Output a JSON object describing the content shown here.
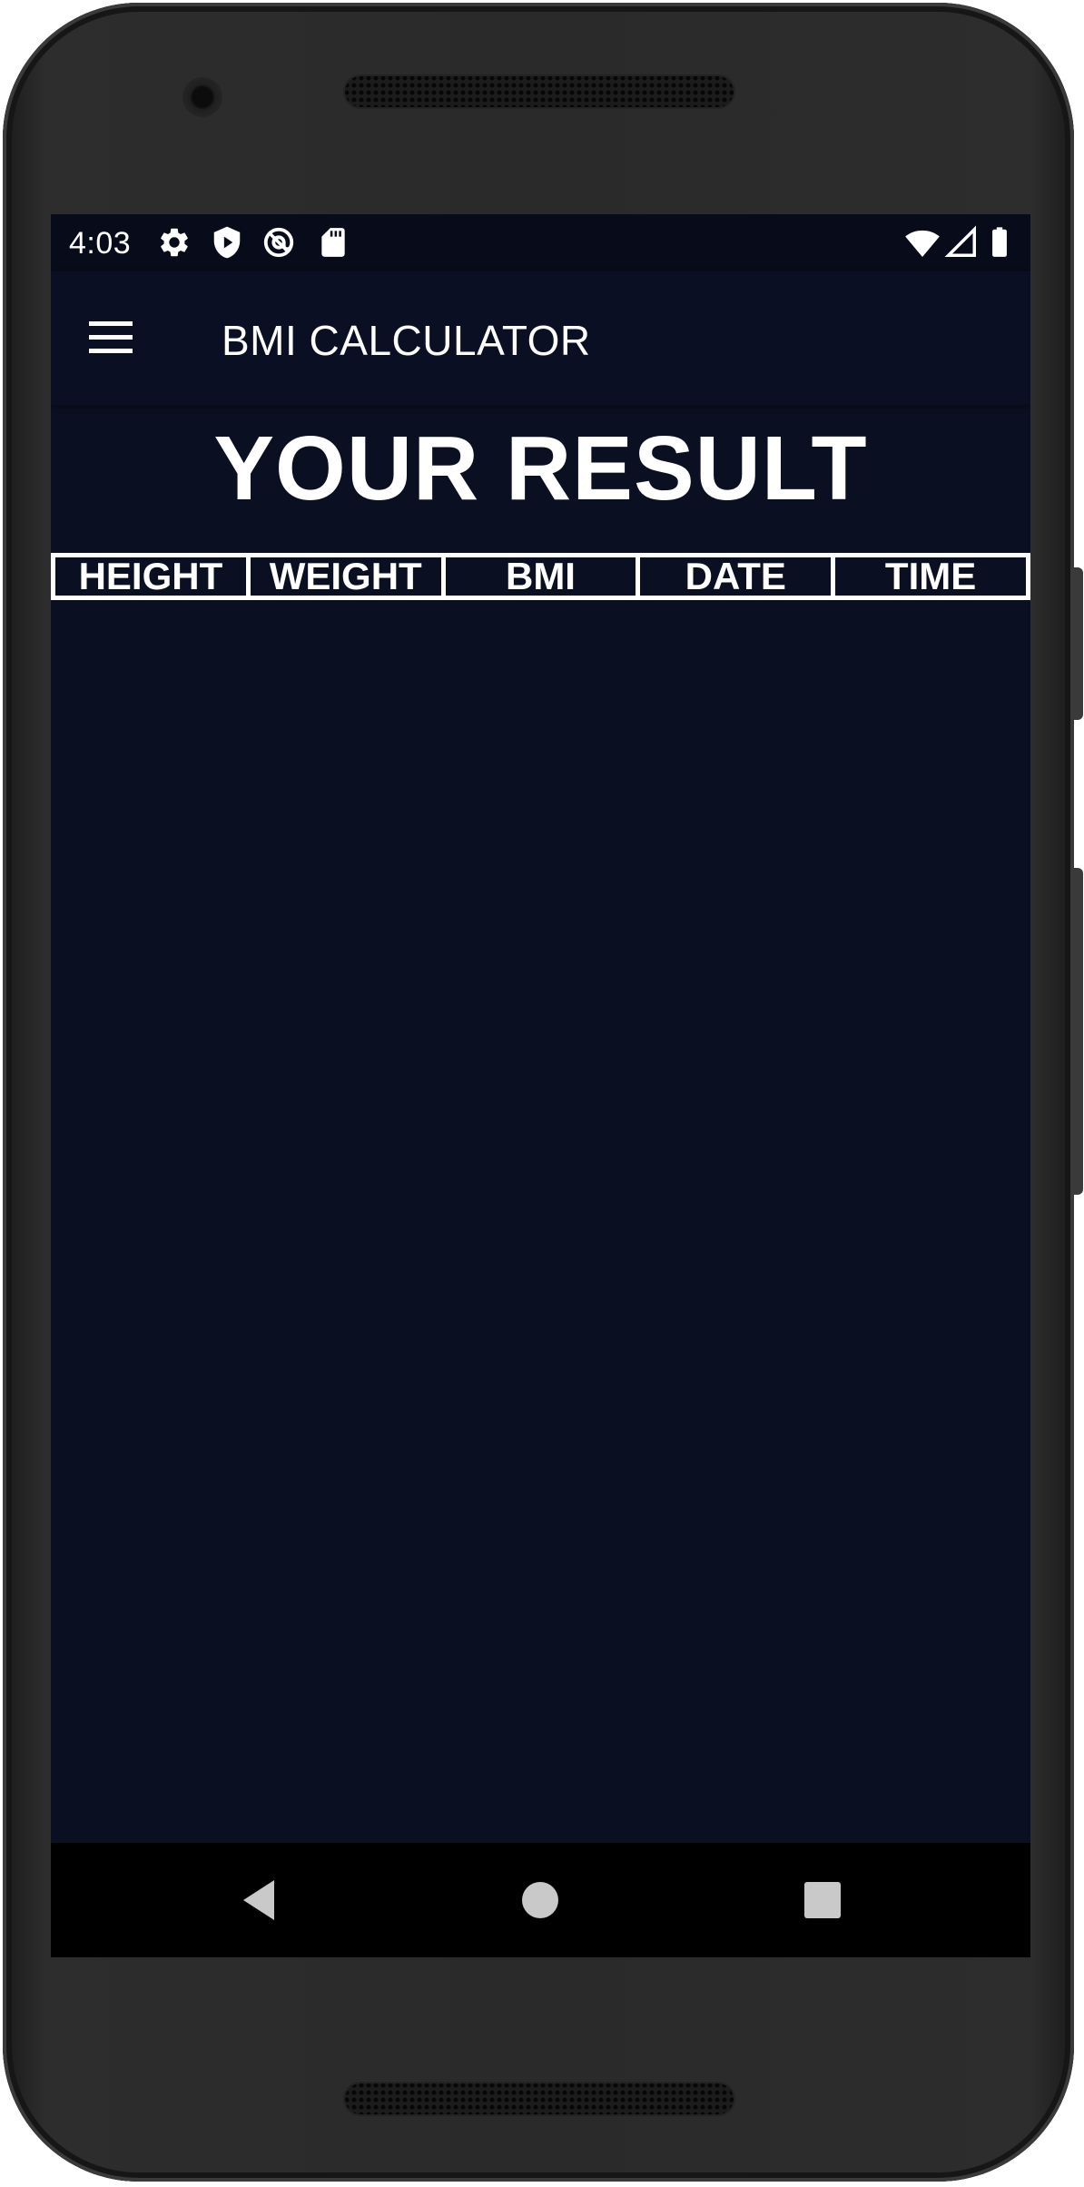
{
  "status_bar": {
    "time": "4:03",
    "left_icons": [
      "settings-icon",
      "shield-play-icon",
      "at-sign-icon",
      "sd-card-icon"
    ],
    "right_icons": [
      "wifi-icon",
      "cell-signal-icon",
      "battery-icon"
    ]
  },
  "app_bar": {
    "title": "BMI CALCULATOR",
    "menu_icon": "menu-icon"
  },
  "main": {
    "heading": "YOUR RESULT",
    "table_headers": [
      "HEIGHT",
      "WEIGHT",
      "BMI",
      "DATE",
      "TIME"
    ],
    "rows": []
  },
  "nav_bar": {
    "buttons": [
      "back-icon",
      "home-icon",
      "recents-icon"
    ]
  },
  "colors": {
    "screen_background": "#0b0f22",
    "status_bar": "#080b19",
    "app_bar": "#0b0f24",
    "text": "#ffffff",
    "nav_bar": "#000000"
  }
}
